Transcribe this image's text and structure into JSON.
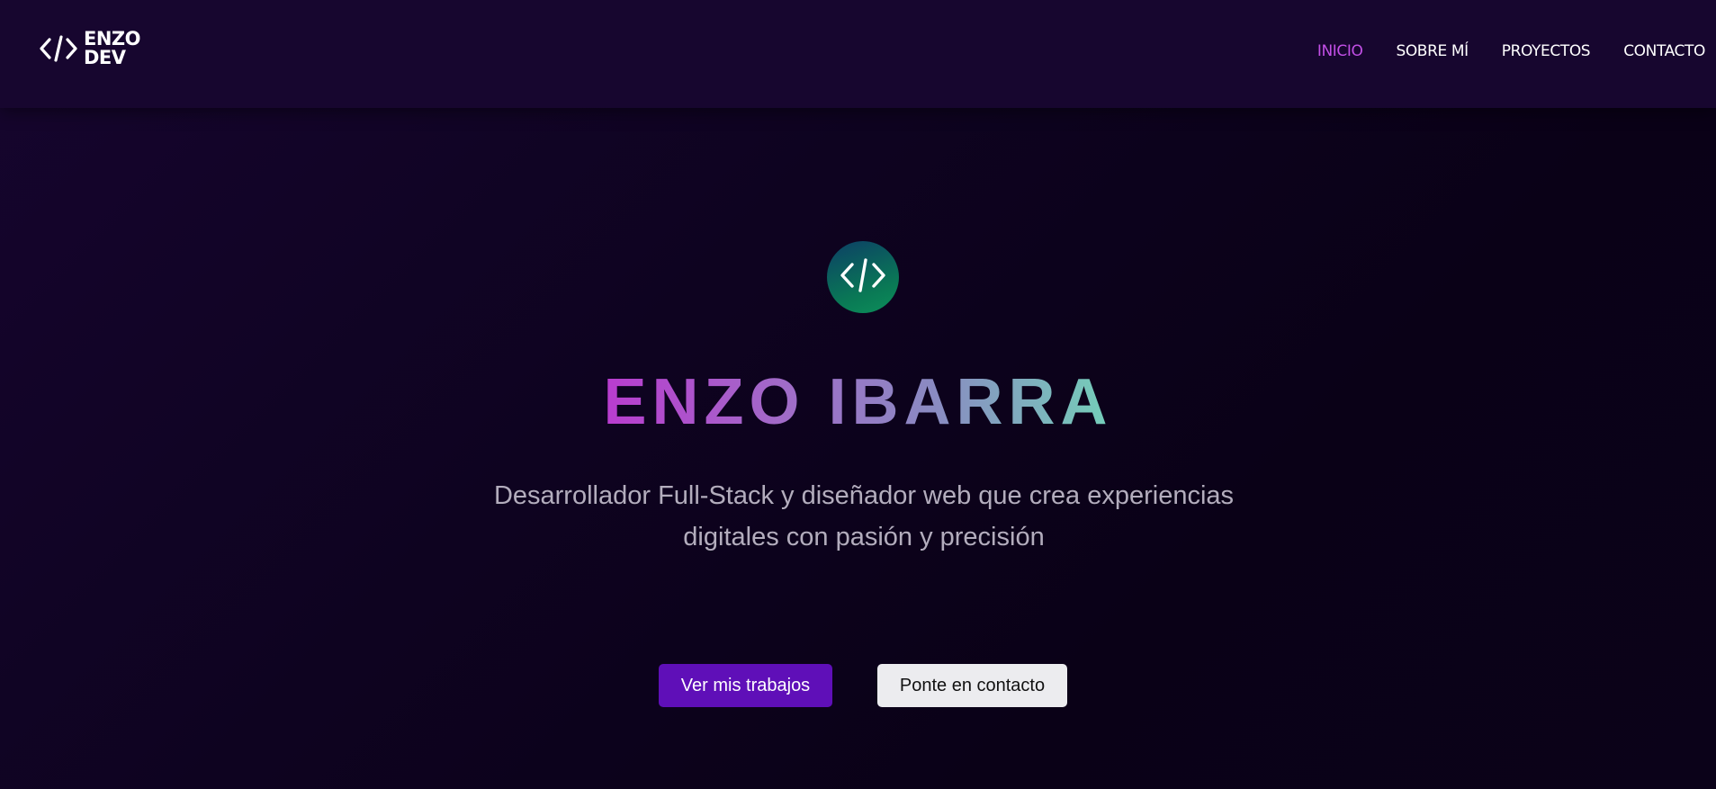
{
  "logo": {
    "line1": "ENZO",
    "line2": "DEV",
    "icon": "code-icon"
  },
  "nav": {
    "items": [
      {
        "label": "INICIO",
        "active": true
      },
      {
        "label": "SOBRE MÍ",
        "active": false
      },
      {
        "label": "PROYECTOS",
        "active": false
      },
      {
        "label": "CONTACTO",
        "active": false
      }
    ]
  },
  "hero": {
    "badge_icon": "code-icon",
    "title": "ENZO IBARRA",
    "subtitle_line1": "Desarrollador Full-Stack y diseñador web que crea experiencias",
    "subtitle_line2": "digitales con pasión y precisión",
    "primary_button": "Ver mis trabajos",
    "secondary_button": "Ponte en contacto"
  },
  "colors": {
    "background": "#0c0218",
    "navbar": "#17062f",
    "nav_active": "#c24fe6",
    "primary_button": "#5f0fb8",
    "secondary_button": "#ececef",
    "title_gradient_start": "#b93ccf",
    "title_gradient_end": "#74d0b9"
  }
}
